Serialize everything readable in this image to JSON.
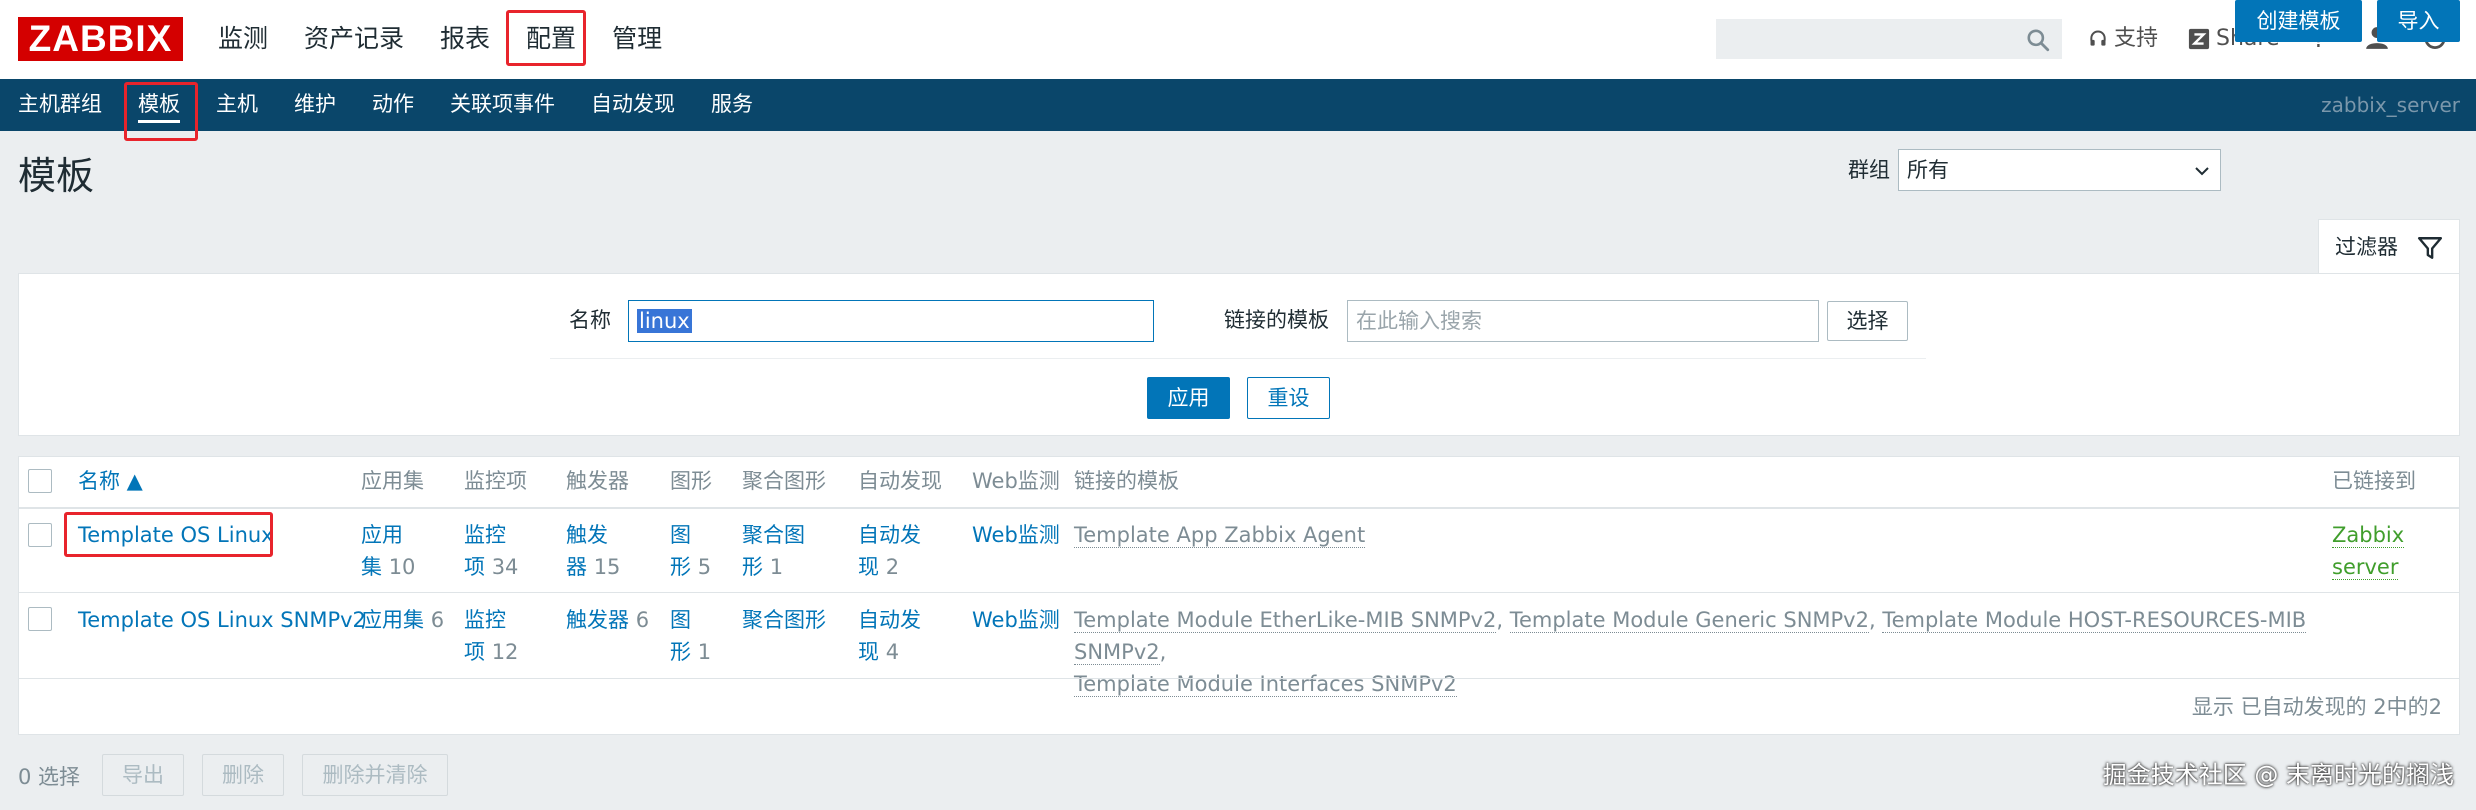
{
  "logo": "ZABBIX",
  "main_menu": [
    {
      "label": "监测"
    },
    {
      "label": "资产记录"
    },
    {
      "label": "报表"
    },
    {
      "label": "配置"
    },
    {
      "label": "管理"
    }
  ],
  "top_links": {
    "support": "支持",
    "share": "Share",
    "help": "?"
  },
  "sub_menu": [
    {
      "label": "主机群组"
    },
    {
      "label": "模板"
    },
    {
      "label": "主机"
    },
    {
      "label": "维护"
    },
    {
      "label": "动作"
    },
    {
      "label": "关联项事件"
    },
    {
      "label": "自动发现"
    },
    {
      "label": "服务"
    }
  ],
  "server_name": "zabbix_server",
  "page": {
    "title": "模板",
    "group_label": "群组",
    "group_value": "所有",
    "create_button": "创建模板",
    "import_button": "导入"
  },
  "filter": {
    "tab_label": "过滤器",
    "name_label": "名称",
    "name_value": "linux",
    "linked_label": "链接的模板",
    "linked_placeholder": "在此输入搜索",
    "select_button": "选择",
    "apply_button": "应用",
    "reset_button": "重设"
  },
  "table": {
    "headers": {
      "name": "名称 ▲",
      "apps": "应用集",
      "items": "监控项",
      "triggers": "触发器",
      "graphs": "图形",
      "screens": "聚合图形",
      "discovery": "自动发现",
      "web": "Web监测",
      "linked": "链接的模板",
      "linked_to": "已链接到"
    },
    "rows": [
      {
        "name": "Template OS Linux",
        "apps_l1": "应用",
        "apps_l2": "集",
        "apps_count": "10",
        "items_l1": "监控",
        "items_l2": "项",
        "items_count": "34",
        "triggers_l1": "触发",
        "triggers_l2": "器",
        "triggers_count": "15",
        "graphs_l1": "图",
        "graphs_l2": "形",
        "graphs_count": "5",
        "screens_l1": "聚合图",
        "screens_l2": "形",
        "screens_count": "1",
        "discovery_l1": "自动发",
        "discovery_l2": "现",
        "discovery_count": "2",
        "web": "Web监测",
        "linked": [
          "Template App Zabbix Agent"
        ],
        "linked_to_l1": "Zabbix",
        "linked_to_l2": "server"
      },
      {
        "name": "Template OS Linux SNMPv2",
        "apps": "应用集",
        "apps_count": "6",
        "items_l1": "监控",
        "items_l2": "项",
        "items_count": "12",
        "triggers": "触发器",
        "triggers_count": "6",
        "graphs_l1": "图",
        "graphs_l2": "形",
        "graphs_count": "1",
        "screens": "聚合图形",
        "discovery_l1": "自动发",
        "discovery_l2": "现",
        "discovery_count": "4",
        "web": "Web监测",
        "linked": [
          "Template Module EtherLike-MIB SNMPv2",
          "Template Module Generic SNMPv2",
          "Template Module HOST-RESOURCES-MIB SNMPv2",
          "Template Module Interfaces SNMPv2"
        ]
      }
    ],
    "footer": "显示 已自动发现的 2中的2"
  },
  "bottom": {
    "selected": "0 选择",
    "export": "导出",
    "delete": "删除",
    "delete_clear": "删除并清除"
  },
  "watermark": "掘金技术社区 @ 末离时光的搁浅",
  "colors": {
    "brand_red": "#d40000",
    "nav_blue": "#0a466a",
    "link_blue": "#0275b8",
    "highlight_red": "#e8242c",
    "green": "#409e2c"
  }
}
